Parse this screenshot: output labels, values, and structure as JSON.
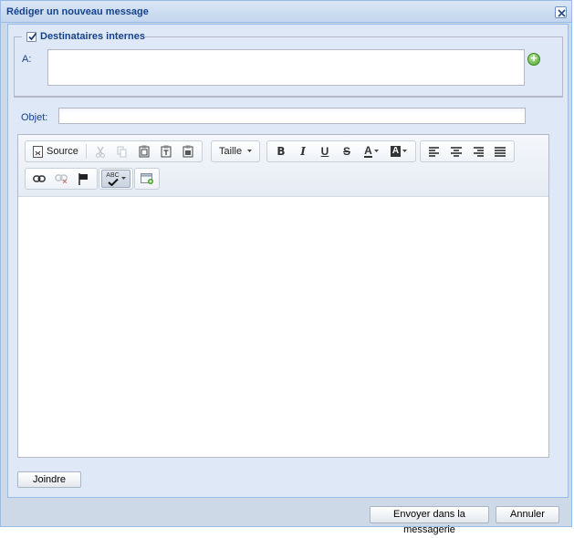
{
  "window": {
    "title": "Rédiger un nouveau message"
  },
  "recipients": {
    "legend": "Destinataires internes",
    "checked": true,
    "to_label": "A:",
    "to_value": ""
  },
  "subject": {
    "label": "Objet:",
    "value": ""
  },
  "toolbar": {
    "source_label": "Source",
    "size_label": "Taille",
    "bold_glyph": "B",
    "italic_glyph": "I",
    "underline_glyph": "U",
    "strike_glyph": "S",
    "text_color_glyph": "A",
    "bg_color_glyph": "A",
    "spellcheck_glyph": "ABC"
  },
  "editor": {
    "content": ""
  },
  "buttons": {
    "attach_label": "Joindre",
    "send_label": "Envoyer dans la messagerie",
    "cancel_label": "Annuler"
  },
  "colors": {
    "title_text": "#15428b",
    "panel_bg": "#dfe8f6",
    "border": "#99bbe8"
  }
}
